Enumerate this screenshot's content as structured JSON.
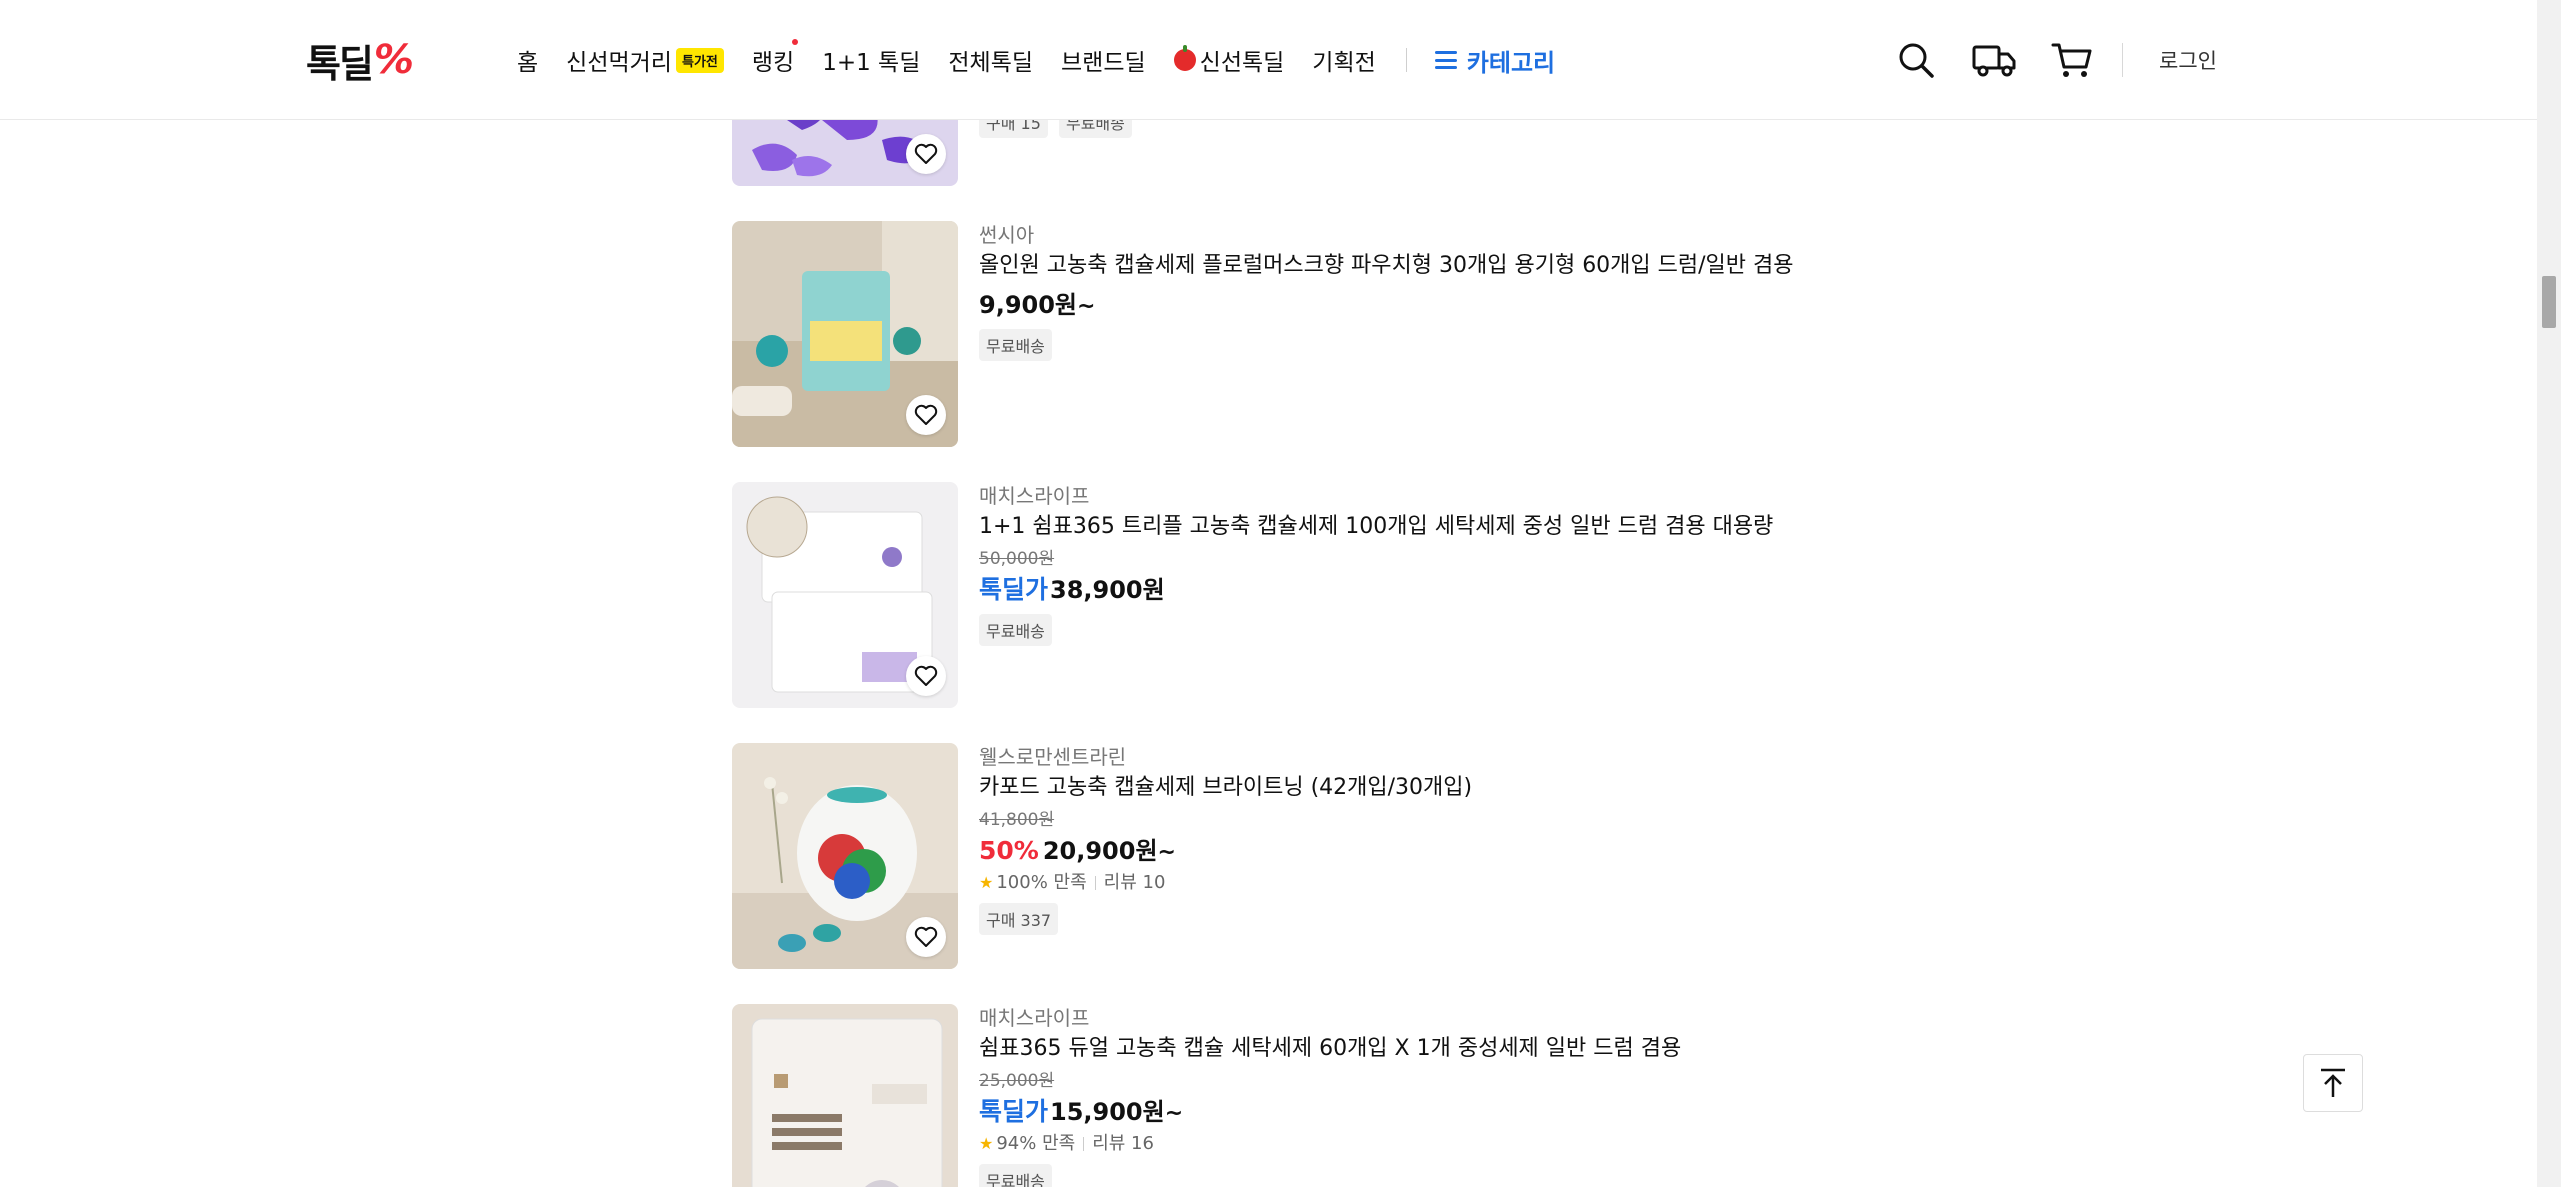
{
  "header": {
    "logo_text": "톡딜",
    "logo_mark": "%",
    "nav": {
      "home": "홈",
      "fresh_food": "신선먹거리",
      "fresh_food_badge": "특가전",
      "ranking": "랭킹",
      "one_plus_one": "1+1 톡딜",
      "all_deals": "전체톡딜",
      "brand_deal": "브랜드딜",
      "fresh_deal": "신선톡딜",
      "exhibition": "기획전",
      "category": "카테고리"
    },
    "icons": [
      "search-icon",
      "delivery-truck-icon",
      "cart-icon"
    ],
    "login": "로그인"
  },
  "colors": {
    "accent_blue": "#1e6fe0",
    "accent_red": "#f02c3a",
    "badge_yellow": "#ffe600"
  },
  "products": [
    {
      "brand": "",
      "title": "",
      "chips": [
        "구매 15",
        "무료배송"
      ]
    },
    {
      "brand": "썬시아",
      "title": "올인원 고농축 캡슐세제 플로럴머스크향 파우치형 30개입 용기형 60개입 드럼/일반 겸용",
      "price": "9,900원",
      "price_suffix": "~",
      "chips": [
        "무료배송"
      ]
    },
    {
      "brand": "매치스라이프",
      "title": "1+1 쉼표365 트리플 고농축 캡슐세제 100개입 세탁세제 중성 일반 드럼 겸용 대용량",
      "original_price": "50,000원",
      "deal_label": "톡딜가",
      "price": "38,900원",
      "chips": [
        "무료배송"
      ]
    },
    {
      "brand": "웰스로만센트라린",
      "title": "카포드 고농축 캡슐세제 브라이트닝 (42개입/30개입)",
      "original_price": "41,800원",
      "discount_rate": "50%",
      "price": "20,900원",
      "price_suffix": "~",
      "satisfaction": "100% 만족",
      "reviews": "리뷰 10",
      "chips": [
        "구매 337"
      ]
    },
    {
      "brand": "매치스라이프",
      "title": "쉼표365 듀얼 고농축 캡슐 세탁세제 60개입 X 1개 중성세제 일반 드럼 겸용",
      "original_price": "25,000원",
      "deal_label": "톡딜가",
      "price": "15,900원",
      "price_suffix": "~",
      "satisfaction": "94% 만족",
      "reviews": "리뷰 16",
      "chips": [
        "무료배송"
      ]
    }
  ]
}
